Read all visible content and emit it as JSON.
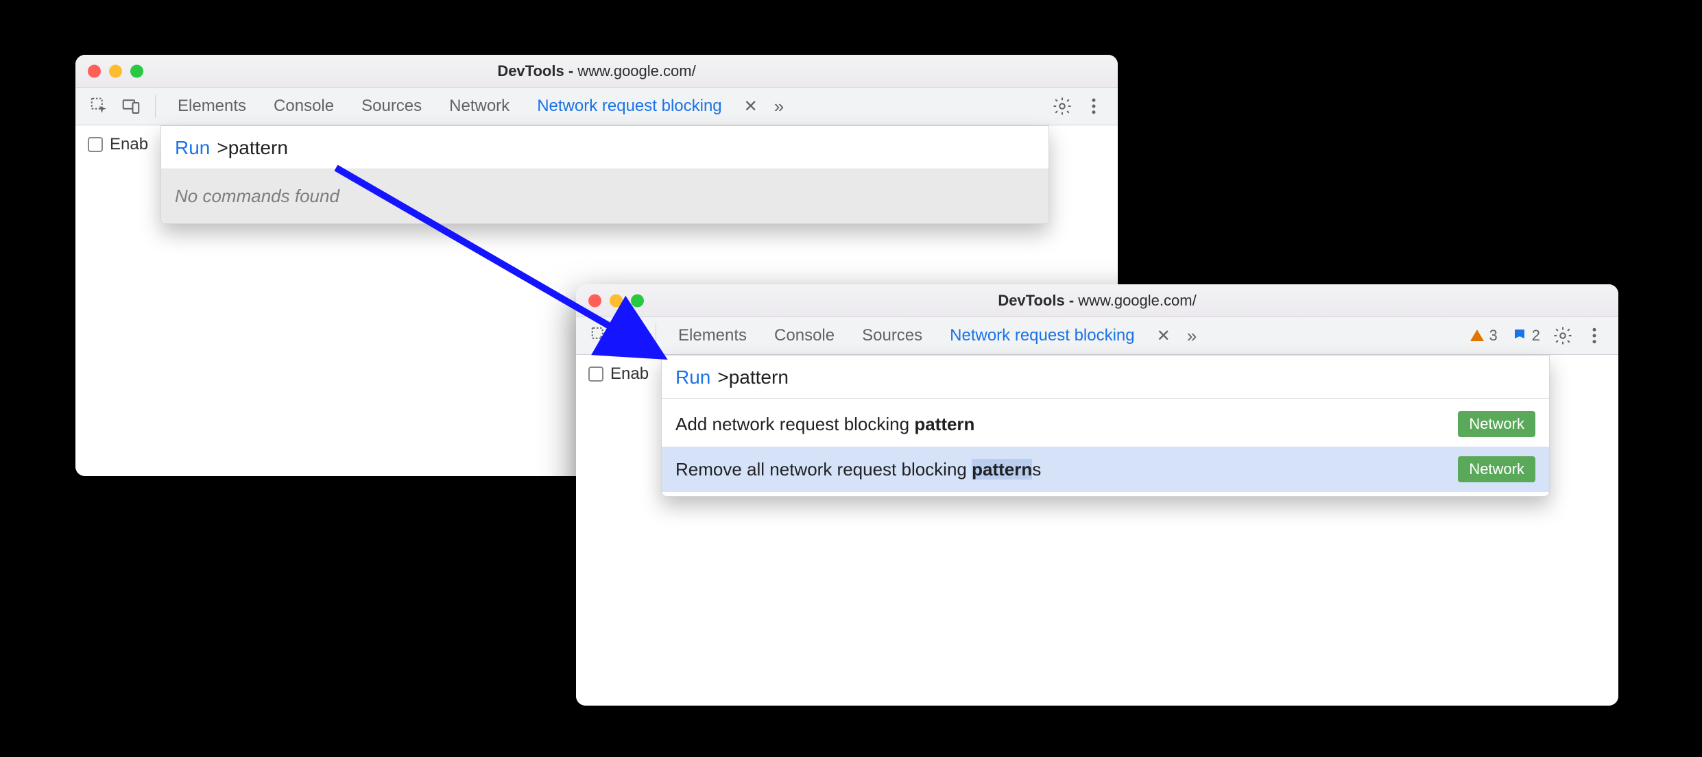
{
  "window_title_prefix": "DevTools - ",
  "window_title_url": "www.google.com/",
  "tabs": {
    "elements": "Elements",
    "console": "Console",
    "sources": "Sources",
    "network": "Network",
    "nrb": "Network request blocking"
  },
  "enable_label_truncated": "Enab",
  "palette": {
    "run_label": "Run",
    "query": ">pattern",
    "empty_text": "No commands found",
    "items": [
      {
        "prefix": "Add network request blocking ",
        "match": "pattern",
        "suffix": "",
        "badge": "Network"
      },
      {
        "prefix": "Remove all network request blocking ",
        "match": "pattern",
        "suffix": "s",
        "badge": "Network"
      }
    ]
  },
  "status": {
    "warning_count": "3",
    "issue_count": "2"
  }
}
